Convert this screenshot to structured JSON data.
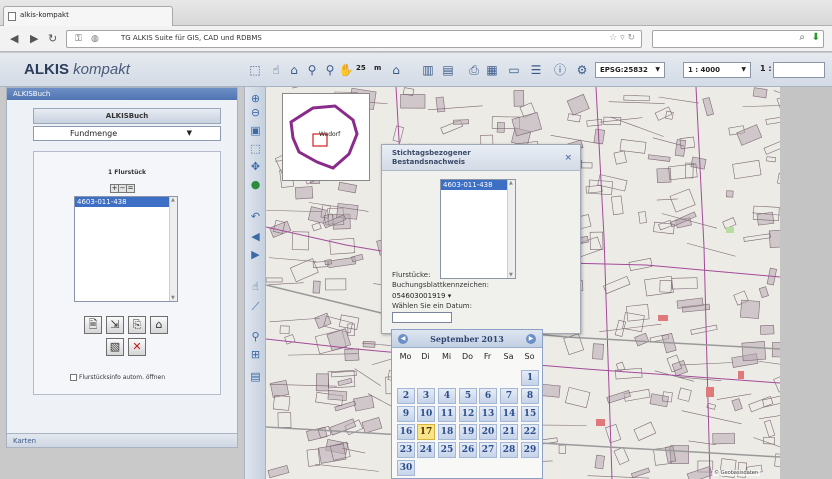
{
  "browser": {
    "tab_title": "alkis-kompakt",
    "url": "TG ALKIS Suite für GIS, CAD und RDBMS"
  },
  "app": {
    "logo_main": "ALKIS",
    "logo_sub": "kompakt"
  },
  "toolbar": {
    "zoom_value": "25",
    "zoom_unit": "m",
    "epsg": "EPSG:25832",
    "scale": "1 : 4000",
    "scale_prefix": "1 :"
  },
  "left_panel": {
    "title": "ALKISBuch",
    "book_header": "ALKISBuch",
    "select_value": "Fundmenge",
    "count_label": "1 Flurstück",
    "list_items": [
      "4603-011-438"
    ],
    "auto_open_label": "Flurstücksinfo autom. öffnen",
    "bottom_section": "Karten"
  },
  "overview": {
    "label": "Wadorf"
  },
  "dialog": {
    "title_line1": "Stichtagsbezogener",
    "title_line2": "Bestandsnachweis",
    "close_symbol": "×",
    "list_items": [
      "4603-011-438"
    ],
    "label_flurstuecke": "Flurstücke:",
    "label_buchung": "Buchungsblattkennzeichen:",
    "buchung_value": "054603001919",
    "label_datum": "Wählen Sie ein Datum:"
  },
  "calendar": {
    "month_label": "September 2013",
    "weekdays": [
      "Mo",
      "Di",
      "Mi",
      "Do",
      "Fr",
      "Sa",
      "So"
    ],
    "today": "17",
    "rows": [
      [
        "",
        "",
        "",
        "",
        "",
        "",
        "1"
      ],
      [
        "2",
        "3",
        "4",
        "5",
        "6",
        "7",
        "8"
      ],
      [
        "9",
        "10",
        "11",
        "12",
        "13",
        "14",
        "15"
      ],
      [
        "16",
        "17",
        "18",
        "19",
        "20",
        "21",
        "22"
      ],
      [
        "23",
        "24",
        "25",
        "26",
        "27",
        "28",
        "29"
      ],
      [
        "30",
        "",
        "",
        "",
        "",
        "",
        ""
      ]
    ]
  },
  "map": {
    "copyright": "© Geobasisdaten"
  },
  "colors": {
    "accent": "#4f74b2",
    "parcel_outline": "#8a2a8a",
    "today": "#fbe487"
  }
}
